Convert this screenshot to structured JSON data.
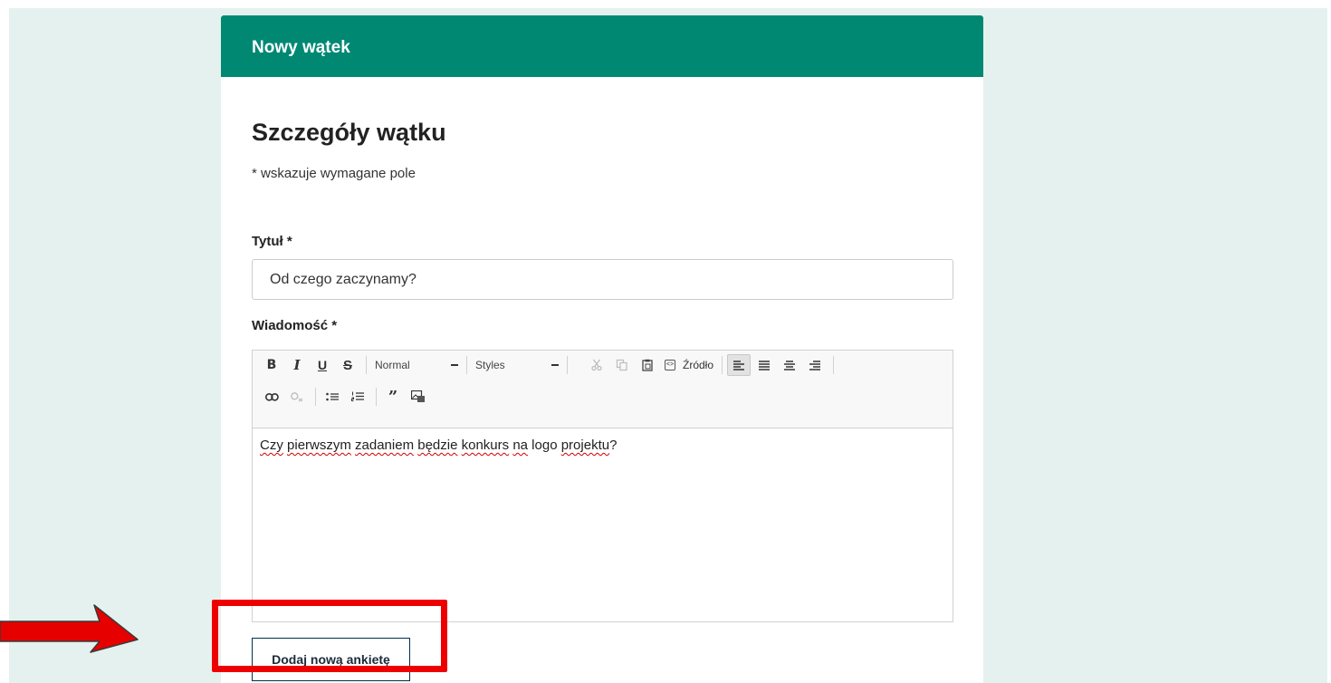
{
  "header": {
    "title": "Nowy wątek"
  },
  "section": {
    "title": "Szczegóły wątku",
    "required_note": "* wskazuje wymagane pole"
  },
  "fields": {
    "title_label": "Tytuł *",
    "title_value": "Od czego zaczynamy?",
    "message_label": "Wiadomość *"
  },
  "toolbar": {
    "format_combo": "Normal",
    "styles_combo": "Styles",
    "source_label": "Źródło"
  },
  "editor": {
    "content_parts": [
      "Czy",
      " ",
      "pierwszym",
      " ",
      "zadaniem",
      " ",
      "będzie",
      " ",
      "konkurs",
      " ",
      "na",
      " logo ",
      "projektu",
      "?"
    ]
  },
  "actions": {
    "add_poll": "Dodaj nową ankietę"
  },
  "colors": {
    "header_bg": "#008873",
    "page_bg": "#e5f1ee",
    "highlight": "#ee0000"
  }
}
